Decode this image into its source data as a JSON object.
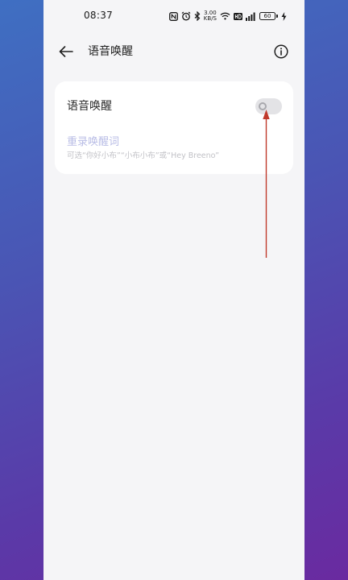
{
  "status_bar": {
    "time": "08:37",
    "net_speed_value": "3.00",
    "net_speed_unit": "KB/S",
    "battery_level": "60",
    "icons": [
      "nfc-icon",
      "alarm-icon",
      "bluetooth-icon",
      "wifi-icon",
      "hd-icon",
      "signal-icon",
      "battery-icon",
      "charging-icon"
    ]
  },
  "header": {
    "title": "语音唤醒",
    "back_icon": "arrow-left-icon",
    "info_icon": "info-icon"
  },
  "settings": {
    "voice_wake": {
      "label": "语音唤醒",
      "enabled": false
    },
    "rerecord": {
      "title": "重录唤醒词",
      "description": "可选“你好小布”“小布小布”或“Hey Breeno”"
    }
  },
  "colors": {
    "annotation_arrow": "#c0392b",
    "disabled_text": "#b9bde6",
    "card_background": "#ffffff",
    "page_background": "#f5f5f7"
  }
}
